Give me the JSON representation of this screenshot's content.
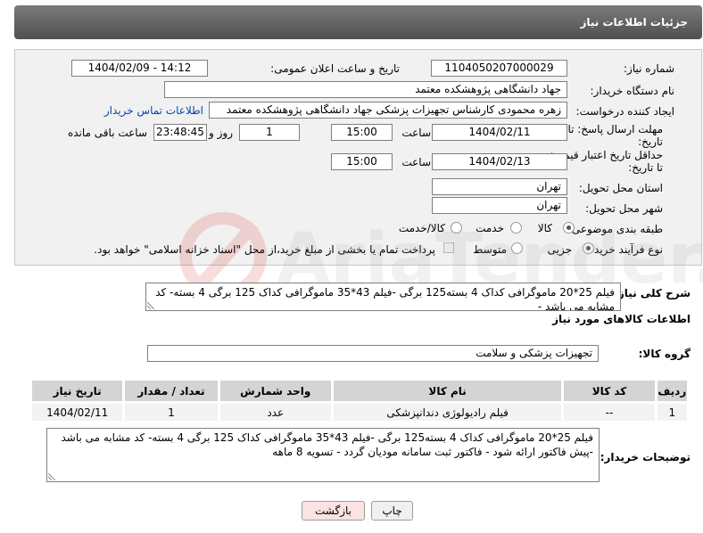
{
  "header": {
    "title": "جزئیات اطلاعات نیاز"
  },
  "form": {
    "need_number_label": "شماره نیاز:",
    "need_number": "1104050207000029",
    "announce_label": "تاریخ و ساعت اعلان عمومی:",
    "announce_value": "1404/02/09 - 14:12",
    "buyer_org_label": "نام دستگاه خریدار:",
    "buyer_org": "جهاد دانشگاهی پژوهشکده معتمد",
    "requester_label": "ایجاد کننده درخواست:",
    "requester": "زهره محمودی کارشناس تجهیزات پزشکی جهاد دانشگاهی پژوهشکده معتمد",
    "contact_link": "اطلاعات تماس خریدار",
    "deadline_label_1": "مهلت ارسال پاسخ: تا",
    "deadline_label_2": "تاریخ:",
    "deadline_date": "1404/02/11",
    "time_label": "ساعت",
    "deadline_time": "15:00",
    "days_value": "1",
    "days_label": "روز و",
    "remaining_time": "23:48:45",
    "remaining_label": "ساعت باقی مانده",
    "price_validity_label_1": "حداقل تاریخ اعتبار قیمت:",
    "price_validity_label_2": "تا تاریخ:",
    "price_validity_date": "1404/02/13",
    "price_validity_time": "15:00",
    "province_label": "استان محل تحویل:",
    "province": "تهران",
    "city_label": "شهر محل تحویل:",
    "city": "تهران",
    "category_label": "طبقه بندی موضوعی:",
    "category_options": [
      "کالا",
      "خدمت",
      "کالا/خدمت"
    ],
    "category_selected": "کالا",
    "process_label": "نوع فرآیند خرید :",
    "process_options": [
      "جزیی",
      "متوسط"
    ],
    "process_selected": "جزیی",
    "payment_note": "پرداخت تمام یا بخشی از مبلغ خرید،از محل \"اسناد خزانه اسلامی\" خواهد بود."
  },
  "need_summary": {
    "label": "شرح کلی نیاز:",
    "text": "فیلم 25*20    ماموگرافی کداک 4 بسته125 برگی -فیلم 43*35 ماموگرافی کداک 125 برگی 4 بسته- کد مشابه می باشد -"
  },
  "goods_section": {
    "title": "اطلاعات کالاهای مورد نیاز",
    "group_label": "گروه کالا:",
    "group_value": "تجهیزات پزشکی و سلامت"
  },
  "table": {
    "headers": [
      "ردیف",
      "کد کالا",
      "نام کالا",
      "واحد شمارش",
      "تعداد / مقدار",
      "تاریخ نیاز"
    ],
    "rows": [
      [
        "1",
        "--",
        "فیلم رادیولوژی دندانپزشکی",
        "عدد",
        "1",
        "1404/02/11"
      ]
    ]
  },
  "buyer_notes": {
    "label": "توضیحات خریدار:",
    "text": "فیلم 25*20    ماموگرافی کداک 4 بسته125 برگی -فیلم 43*35 ماموگرافی کداک 125 برگی 4 بسته- کد مشابه می باشد -پیش فاکتور ارائه شود - فاکتور ثبت سامانه مودیان گردد - تسویه 8 ماهه"
  },
  "buttons": {
    "print": "چاپ",
    "back": "بازگشت"
  },
  "colors": {
    "header_bg": "#5f5f5f",
    "panel_bg": "#f1f1f1",
    "link": "#0645ad",
    "back_button_bg": "#fbe3e3"
  }
}
